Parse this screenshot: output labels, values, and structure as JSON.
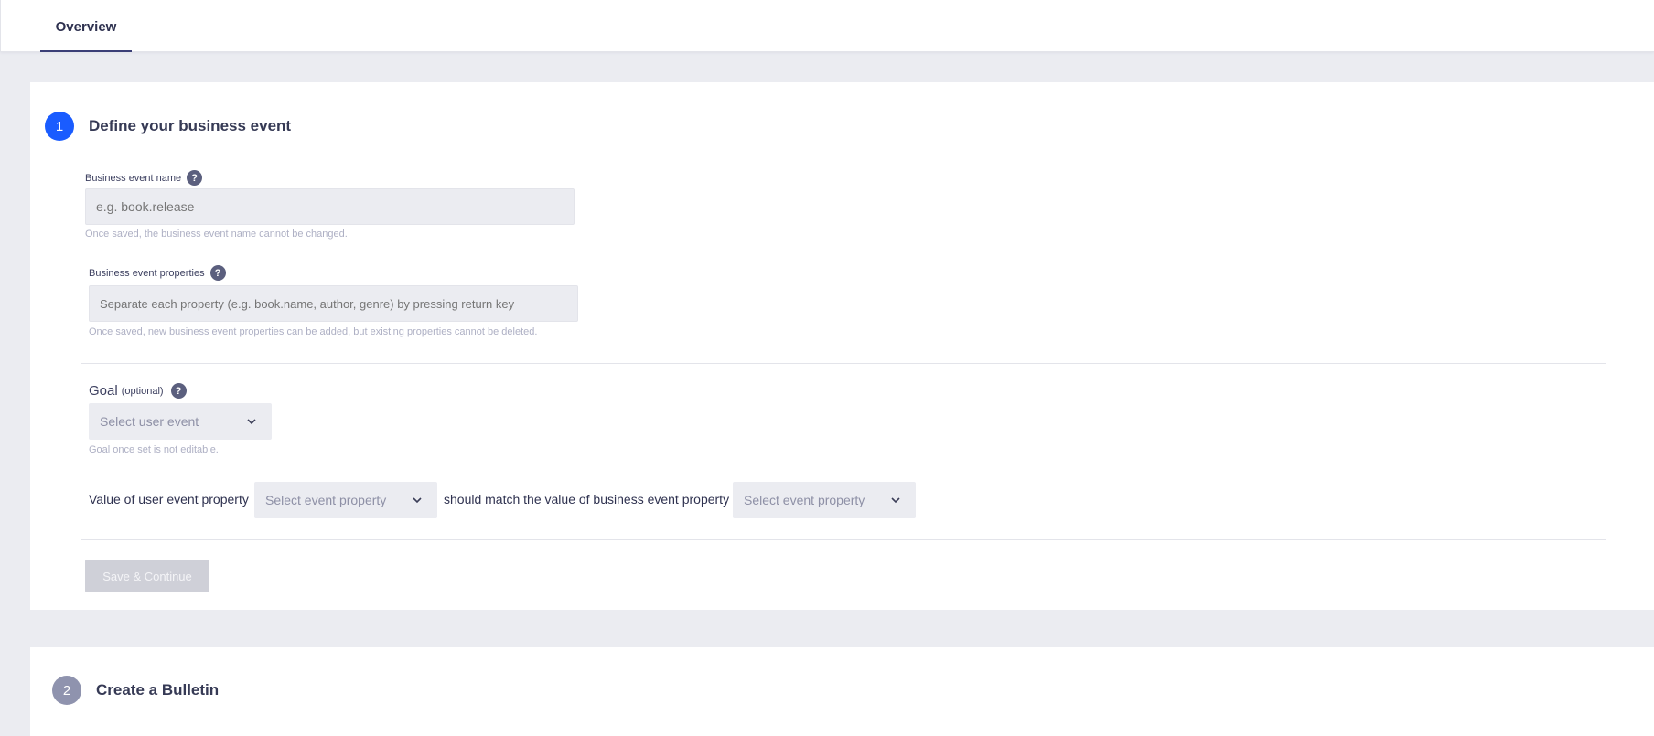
{
  "tabs": {
    "overview_label": "Overview"
  },
  "step1": {
    "number": "1",
    "title": "Define your business event",
    "circle_color": "#1a5cff",
    "event_name": {
      "label": "Business event name",
      "placeholder": "e.g. book.release",
      "hint": "Once saved, the business event name cannot be changed."
    },
    "event_properties": {
      "label": "Business event properties",
      "placeholder": "Separate each property (e.g. book.name, author, genre) by pressing return key",
      "hint": "Once saved, new business event properties can be added, but existing properties cannot be deleted."
    },
    "goal": {
      "label": "Goal",
      "optional": "(optional)",
      "select_value": "Select user event",
      "hint": "Goal once set is not editable."
    },
    "match": {
      "prefix": "Value of user event property",
      "user_property_select": "Select event property",
      "middle": "should match the value of business event property",
      "business_property_select": "Select event property"
    },
    "save_label": "Save & Continue"
  },
  "step2": {
    "number": "2",
    "title": "Create a Bulletin",
    "circle_color": "#8f93ae"
  },
  "help_icon_glyph": "?"
}
